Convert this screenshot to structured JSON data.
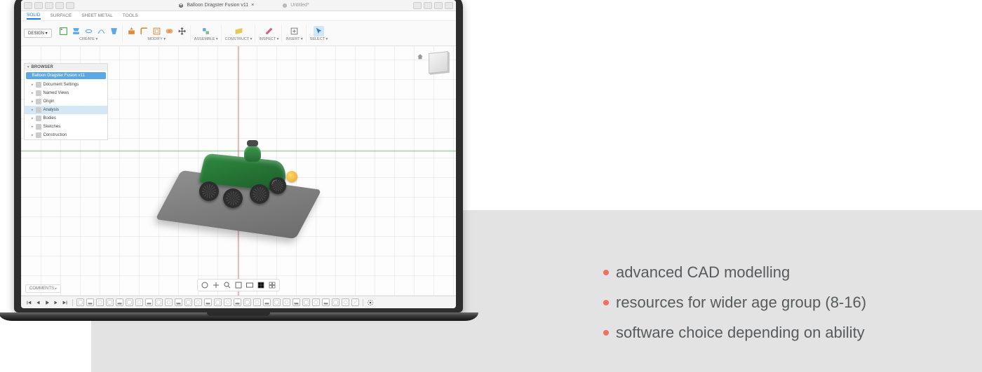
{
  "doc_tabs": {
    "active": "Balloon Dragster Fusion v11",
    "inactive": "Untitled*"
  },
  "ribbon_tabs": [
    "SOLID",
    "SURFACE",
    "SHEET METAL",
    "TOOLS"
  ],
  "ribbon_tabs_active": "SOLID",
  "design_label": "DESIGN ▾",
  "ribbon_groups": {
    "create": "CREATE ▾",
    "modify": "MODIFY ▾",
    "assemble": "ASSEMBLE ▾",
    "construct": "CONSTRUCT ▾",
    "inspect": "INSPECT ▾",
    "insert": "INSERT ▾",
    "select": "SELECT ▾"
  },
  "browser": {
    "title": "BROWSER",
    "root": "Balloon Dragster Fusion v11",
    "items": [
      "Document Settings",
      "Named Views",
      "Origin",
      "Analysis",
      "Bodies",
      "Sketches",
      "Construction"
    ]
  },
  "comments_label": "COMMENTS",
  "bullets": [
    "advanced CAD modelling",
    "resources for wider age group (8-16)",
    "software choice depending on ability"
  ]
}
